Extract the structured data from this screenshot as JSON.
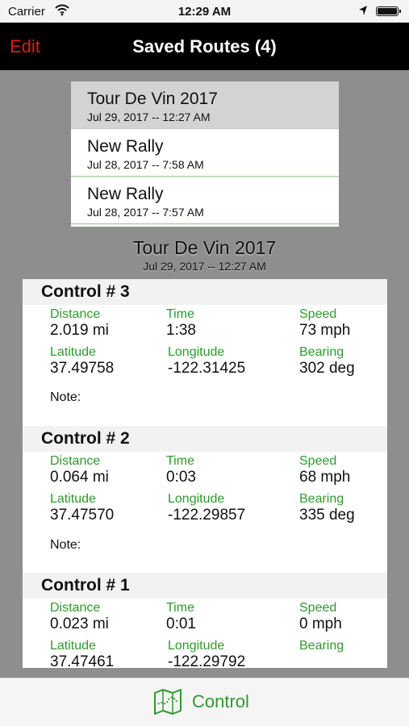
{
  "status_bar": {
    "carrier": "Carrier",
    "time": "12:29 AM"
  },
  "nav": {
    "edit_label": "Edit",
    "title": "Saved Routes (4)"
  },
  "routes": [
    {
      "name": "Tour De Vin 2017",
      "date": "Jul 29, 2017 -- 12:27 AM",
      "selected": true
    },
    {
      "name": "New Rally",
      "date": "Jul 28, 2017 -- 7:58 AM"
    },
    {
      "name": "New Rally",
      "date": "Jul 28, 2017 -- 7:57 AM"
    }
  ],
  "detail": {
    "title": "Tour De Vin 2017",
    "date": "Jul 29, 2017 -- 12:27 AM"
  },
  "field_labels": {
    "distance": "Distance",
    "time": "Time",
    "speed": "Speed",
    "latitude": "Latitude",
    "longitude": "Longitude",
    "bearing": "Bearing",
    "note": "Note:"
  },
  "controls": [
    {
      "title": "Control # 3",
      "distance": "2.019 mi",
      "time": "1:38",
      "speed": "73 mph",
      "latitude": "37.49758",
      "longitude": "-122.31425",
      "bearing": "302 deg"
    },
    {
      "title": "Control # 2",
      "distance": "0.064 mi",
      "time": "0:03",
      "speed": "68 mph",
      "latitude": "37.47570",
      "longitude": "-122.29857",
      "bearing": "335 deg"
    },
    {
      "title": "Control # 1",
      "distance": "0.023 mi",
      "time": "0:01",
      "speed": "0 mph",
      "latitude": "37.47461",
      "longitude": "-122.29792",
      "bearing": ""
    }
  ],
  "tab_bar": {
    "label": "Control",
    "icon": "map-icon"
  },
  "colors": {
    "accent_green": "#2e9a2e",
    "edit_red": "#e21b1b",
    "nav_bg": "#000000",
    "backdrop": "#8e8e8e"
  }
}
